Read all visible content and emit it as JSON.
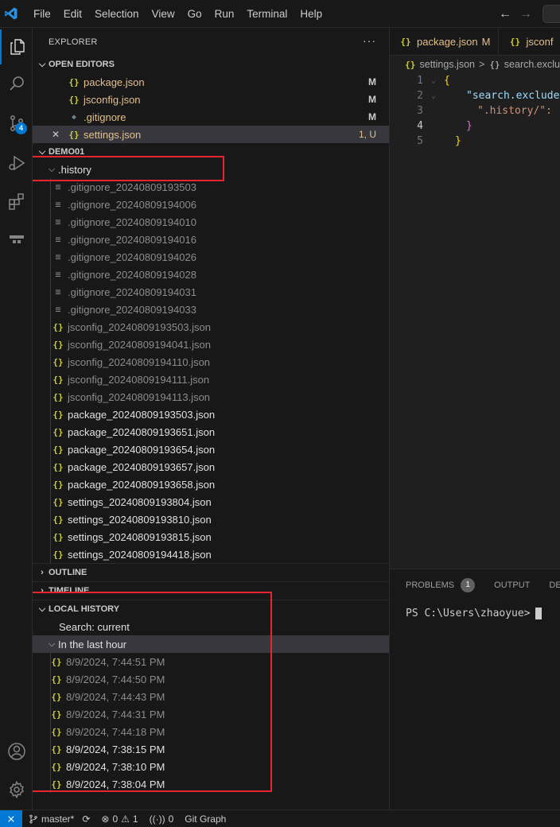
{
  "menu": [
    "File",
    "Edit",
    "Selection",
    "View",
    "Go",
    "Run",
    "Terminal",
    "Help"
  ],
  "activity_badge": "4",
  "explorer": {
    "title": "EXPLORER",
    "more": "···",
    "open_editors": {
      "header": "OPEN EDITORS",
      "items": [
        {
          "name": "package.json",
          "status": "M",
          "icon": "json-icon",
          "close": ""
        },
        {
          "name": "jsconfig.json",
          "status": "M",
          "icon": "json-icon",
          "close": ""
        },
        {
          "name": ".gitignore",
          "status": "M",
          "icon": "git-file-icon",
          "close": ""
        },
        {
          "name": "settings.json",
          "status": "1, U",
          "icon": "json-icon",
          "close": "✕"
        }
      ]
    },
    "workspace": {
      "header": "DEMO01",
      "folder": ".history",
      "files": [
        {
          "name": ".gitignore_20240809193503",
          "icon": "text-file-icon"
        },
        {
          "name": ".gitignore_20240809194006",
          "icon": "text-file-icon"
        },
        {
          "name": ".gitignore_20240809194010",
          "icon": "text-file-icon"
        },
        {
          "name": ".gitignore_20240809194016",
          "icon": "text-file-icon"
        },
        {
          "name": ".gitignore_20240809194026",
          "icon": "text-file-icon"
        },
        {
          "name": ".gitignore_20240809194028",
          "icon": "text-file-icon"
        },
        {
          "name": ".gitignore_20240809194031",
          "icon": "text-file-icon"
        },
        {
          "name": ".gitignore_20240809194033",
          "icon": "text-file-icon"
        },
        {
          "name": "jsconfig_20240809193503.json",
          "icon": "json-icon"
        },
        {
          "name": "jsconfig_20240809194041.json",
          "icon": "json-icon"
        },
        {
          "name": "jsconfig_20240809194110.json",
          "icon": "json-icon"
        },
        {
          "name": "jsconfig_20240809194111.json",
          "icon": "json-icon"
        },
        {
          "name": "jsconfig_20240809194113.json",
          "icon": "json-icon"
        },
        {
          "name": "package_20240809193503.json",
          "icon": "json-icon"
        },
        {
          "name": "package_20240809193651.json",
          "icon": "json-icon"
        },
        {
          "name": "package_20240809193654.json",
          "icon": "json-icon"
        },
        {
          "name": "package_20240809193657.json",
          "icon": "json-icon"
        },
        {
          "name": "package_20240809193658.json",
          "icon": "json-icon"
        },
        {
          "name": "settings_20240809193804.json",
          "icon": "json-icon"
        },
        {
          "name": "settings_20240809193810.json",
          "icon": "json-icon"
        },
        {
          "name": "settings_20240809193815.json",
          "icon": "json-icon"
        },
        {
          "name": "settings_20240809194418.json",
          "icon": "json-icon"
        }
      ]
    },
    "outline_header": "OUTLINE",
    "timeline_header": "TIMELINE",
    "local_history": {
      "header": "LOCAL HISTORY",
      "search": "Search: current",
      "group": "In the last hour",
      "entries": [
        "8/9/2024, 7:44:51 PM",
        "8/9/2024, 7:44:50 PM",
        "8/9/2024, 7:44:43 PM",
        "8/9/2024, 7:44:31 PM",
        "8/9/2024, 7:44:18 PM",
        "8/9/2024, 7:38:15 PM",
        "8/9/2024, 7:38:10 PM",
        "8/9/2024, 7:38:04 PM"
      ]
    }
  },
  "editor": {
    "tabs": [
      {
        "label": "package.json",
        "status": "M"
      },
      {
        "label": "jsconf",
        "status": ""
      }
    ],
    "breadcrumb": {
      "file": "settings.json",
      "sep": ">",
      "node": "search.exclu"
    },
    "lines": [
      {
        "n": "1",
        "text": "{"
      },
      {
        "n": "2",
        "text": "\"search.exclude"
      },
      {
        "n": "3",
        "text": "\".history/\": "
      },
      {
        "n": "4",
        "text": "}"
      },
      {
        "n": "5",
        "text": "}"
      }
    ]
  },
  "panel": {
    "tabs": [
      "PROBLEMS",
      "OUTPUT",
      "DEBU"
    ],
    "problems_count": "1",
    "terminal_prompt": "PS C:\\Users\\zhaoyue>"
  },
  "statusbar": {
    "branch": "master*",
    "errors": "0",
    "warnings": "1",
    "ports": "0",
    "git_graph": "Git Graph"
  },
  "colors": {
    "accent": "#0078d4",
    "highlight_box": "#e8242f",
    "modified": "#e2c08d"
  }
}
